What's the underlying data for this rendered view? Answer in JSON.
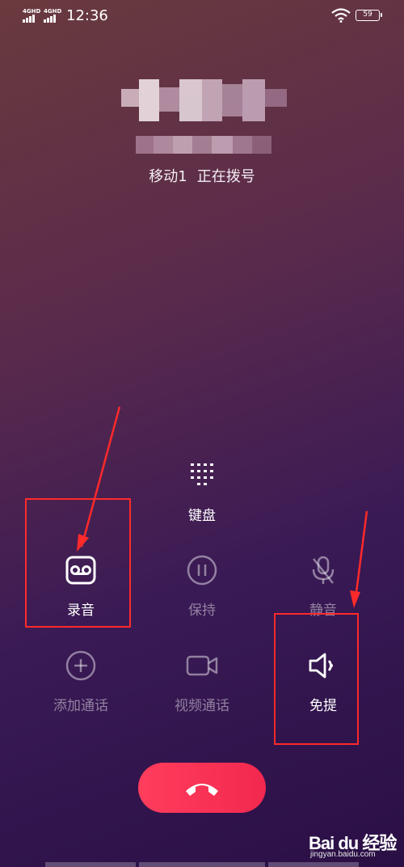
{
  "status_bar": {
    "sim1_network": "4GHD",
    "sim2_network": "4GHD",
    "time": "12:36",
    "battery_level": "59"
  },
  "call": {
    "status_line": {
      "carrier": "移动1",
      "state": "正在拨号"
    }
  },
  "controls": {
    "keypad": {
      "label": "键盘",
      "icon": "dialpad-icon"
    },
    "record": {
      "label": "录音",
      "icon": "voicemail-record-icon"
    },
    "hold": {
      "label": "保持",
      "icon": "pause-icon"
    },
    "mute": {
      "label": "静音",
      "icon": "mic-off-icon"
    },
    "add_call": {
      "label": "添加通话",
      "icon": "plus-circle-icon"
    },
    "video_call": {
      "label": "视频通话",
      "icon": "video-camera-icon"
    },
    "speaker": {
      "label": "免提",
      "icon": "speaker-icon"
    }
  },
  "end_call": {
    "icon": "phone-hangup-icon"
  },
  "watermark": {
    "brand": "Bai du 经验",
    "url": "jingyan.baidu.com"
  },
  "colors": {
    "end_call": "#f2284f",
    "annotation": "#ff2a2a",
    "active_label": "#ffffff",
    "inactive_label": "rgba(255,255,255,0.45)"
  }
}
